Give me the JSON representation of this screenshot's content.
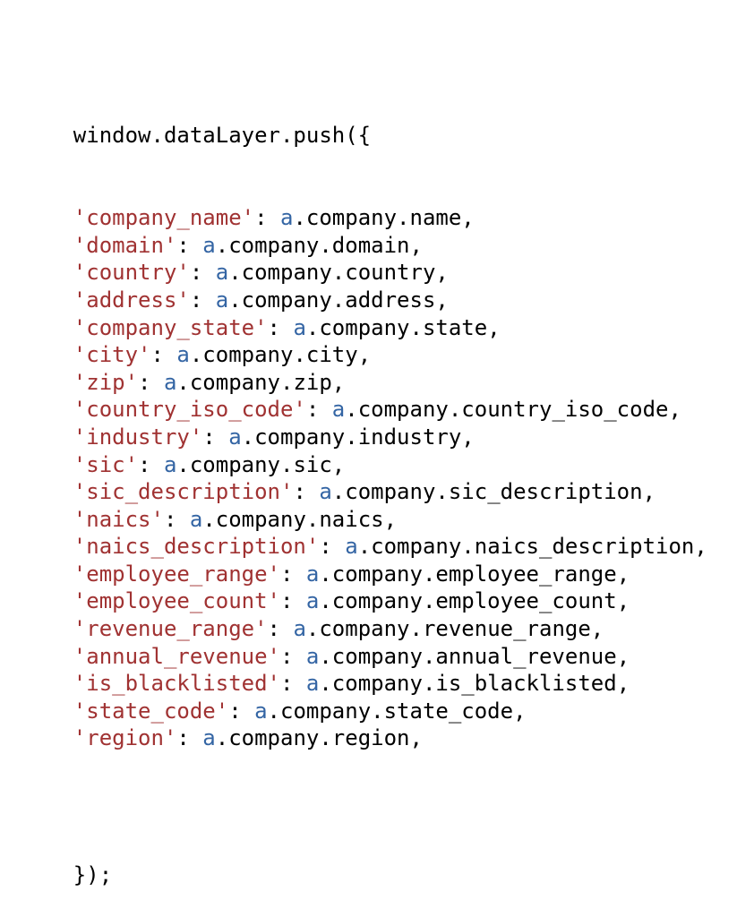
{
  "document": {
    "type": "code-snippet",
    "language": "javascript",
    "background_color": "#ffffff",
    "font_size_px": 24,
    "line_height_px": 30.6,
    "indent": "    "
  },
  "colors": {
    "plain": "#000000",
    "string": "#a03232",
    "identifier": "#3465a4",
    "punctuation": "#000000",
    "background": "#ffffff"
  },
  "code": {
    "open_statement": "window.dataLayer.push({",
    "close_statement": "});",
    "object_ref": "a",
    "property_prefix": ".company.",
    "indent": "    ",
    "entries": [
      {
        "key": "company_name",
        "value_path": "a.company.name"
      },
      {
        "key": "domain",
        "value_path": "a.company.domain"
      },
      {
        "key": "country",
        "value_path": "a.company.country"
      },
      {
        "key": "address",
        "value_path": "a.company.address"
      },
      {
        "key": "company_state",
        "value_path": "a.company.state"
      },
      {
        "key": "city",
        "value_path": "a.company.city"
      },
      {
        "key": "zip",
        "value_path": "a.company.zip"
      },
      {
        "key": "country_iso_code",
        "value_path": "a.company.country_iso_code"
      },
      {
        "key": "industry",
        "value_path": "a.company.industry"
      },
      {
        "key": "sic",
        "value_path": "a.company.sic"
      },
      {
        "key": "sic_description",
        "value_path": "a.company.sic_description"
      },
      {
        "key": "naics",
        "value_path": "a.company.naics"
      },
      {
        "key": "naics_description",
        "value_path": "a.company.naics_description"
      },
      {
        "key": "employee_range",
        "value_path": "a.company.employee_range"
      },
      {
        "key": "employee_count",
        "value_path": "a.company.employee_count"
      },
      {
        "key": "revenue_range",
        "value_path": "a.company.revenue_range"
      },
      {
        "key": "annual_revenue",
        "value_path": "a.company.annual_revenue"
      },
      {
        "key": "is_blacklisted",
        "value_path": "a.company.is_blacklisted"
      },
      {
        "key": "state_code",
        "value_path": "a.company.state_code"
      },
      {
        "key": "region",
        "value_path": "a.company.region"
      }
    ]
  }
}
